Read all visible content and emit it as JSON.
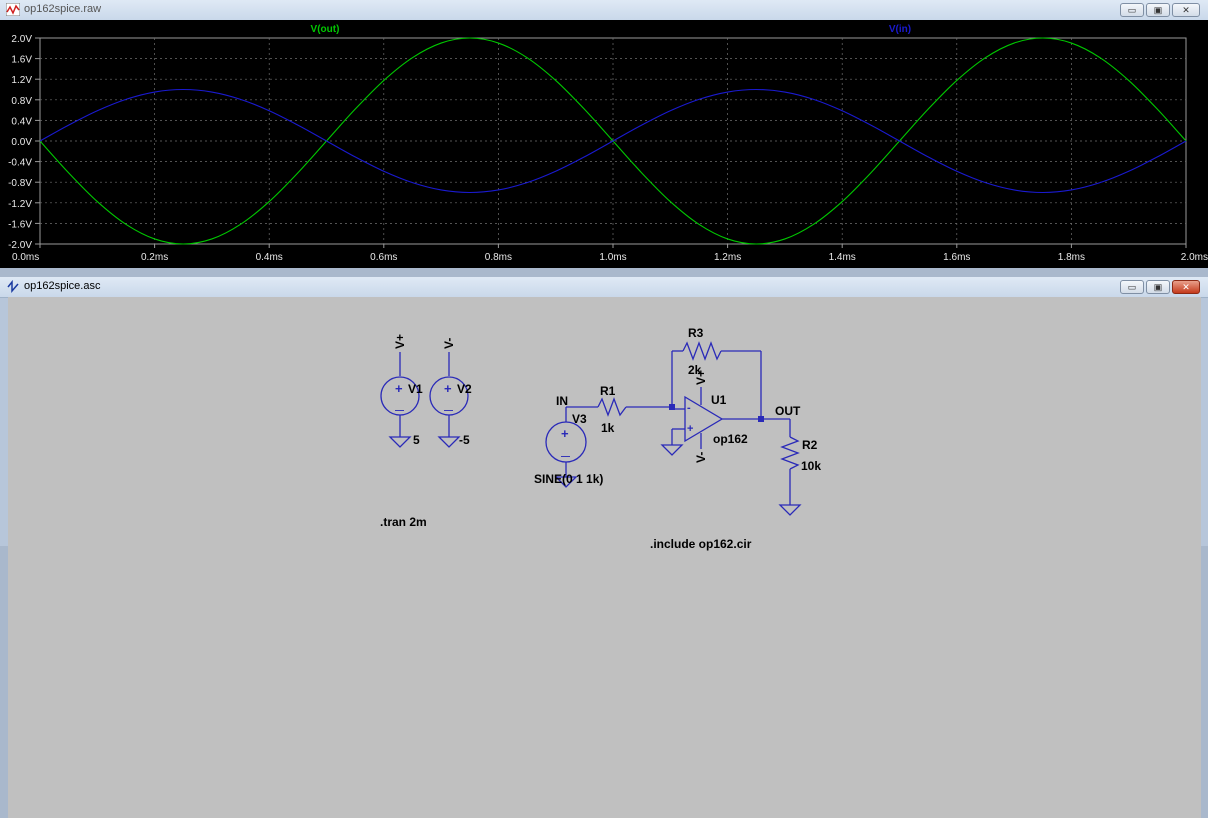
{
  "waveform_window": {
    "title": "op162spice.raw",
    "controls": [
      "minimize",
      "maximize",
      "close"
    ]
  },
  "chart_data": {
    "type": "line",
    "title": "",
    "xlabel": "",
    "ylabel": "",
    "xlim": [
      0,
      2.0
    ],
    "ylim": [
      -2.0,
      2.0
    ],
    "grid": true,
    "x_unit": "ms",
    "y_unit": "V",
    "x_ticks": [
      "0.0ms",
      "0.2ms",
      "0.4ms",
      "0.6ms",
      "0.8ms",
      "1.0ms",
      "1.2ms",
      "1.4ms",
      "1.6ms",
      "1.8ms",
      "2.0ms"
    ],
    "y_ticks": [
      "2.0V",
      "1.6V",
      "1.2V",
      "0.8V",
      "0.4V",
      "0.0V",
      "-0.4V",
      "-0.8V",
      "-1.2V",
      "-1.6V",
      "-2.0V"
    ],
    "series": [
      {
        "name": "V(out)",
        "color": "#00c800",
        "x": [
          0,
          0.05,
          0.1,
          0.15,
          0.2,
          0.25,
          0.3,
          0.35,
          0.4,
          0.45,
          0.5,
          0.55,
          0.6,
          0.65,
          0.7,
          0.75,
          0.8,
          0.85,
          0.9,
          0.95,
          1.0,
          1.05,
          1.1,
          1.15,
          1.2,
          1.25,
          1.3,
          1.35,
          1.4,
          1.45,
          1.5,
          1.55,
          1.6,
          1.65,
          1.7,
          1.75,
          1.8,
          1.85,
          1.9,
          1.95,
          2.0
        ],
        "y": [
          0,
          -0.618,
          -1.176,
          -1.618,
          -1.902,
          -2.0,
          -1.902,
          -1.618,
          -1.176,
          -0.618,
          0,
          0.618,
          1.176,
          1.618,
          1.902,
          2.0,
          1.902,
          1.618,
          1.176,
          0.618,
          0,
          -0.618,
          -1.176,
          -1.618,
          -1.902,
          -2.0,
          -1.902,
          -1.618,
          -1.176,
          -0.618,
          0,
          0.618,
          1.176,
          1.618,
          1.902,
          2.0,
          1.902,
          1.618,
          1.176,
          0.618,
          0
        ]
      },
      {
        "name": "V(in)",
        "color": "#1a1ad0",
        "x": [
          0,
          0.05,
          0.1,
          0.15,
          0.2,
          0.25,
          0.3,
          0.35,
          0.4,
          0.45,
          0.5,
          0.55,
          0.6,
          0.65,
          0.7,
          0.75,
          0.8,
          0.85,
          0.9,
          0.95,
          1.0,
          1.05,
          1.1,
          1.15,
          1.2,
          1.25,
          1.3,
          1.35,
          1.4,
          1.45,
          1.5,
          1.55,
          1.6,
          1.65,
          1.7,
          1.75,
          1.8,
          1.85,
          1.9,
          1.95,
          2.0
        ],
        "y": [
          0,
          0.309,
          0.588,
          0.809,
          0.951,
          1.0,
          0.951,
          0.809,
          0.588,
          0.309,
          0,
          -0.309,
          -0.588,
          -0.809,
          -0.951,
          -1.0,
          -0.951,
          -0.809,
          -0.588,
          -0.309,
          0,
          0.309,
          0.588,
          0.809,
          0.951,
          1.0,
          0.951,
          0.809,
          0.588,
          0.309,
          0,
          -0.309,
          -0.588,
          -0.809,
          -0.951,
          -1.0,
          -0.951,
          -0.809,
          -0.588,
          -0.309,
          0
        ]
      }
    ]
  },
  "schematic_window": {
    "title": "op162spice.asc",
    "controls": [
      "minimize",
      "maximize",
      "close"
    ],
    "labels": {
      "vplus": "V+",
      "vminus": "V-",
      "v1": "V1",
      "v2": "V2",
      "v1_value": "5",
      "v2_value": "-5",
      "in_net": "IN",
      "v3": "V3",
      "v3_value": "SINE(0 1 1k)",
      "r1": "R1",
      "r1_value": "1k",
      "r3": "R3",
      "r3_value": "2k",
      "u1": "U1",
      "u1_value": "op162",
      "out_net": "OUT",
      "r2": "R2",
      "r2_value": "10k",
      "tran": ".tran 2m",
      "include": ".include op162.cir",
      "opamp_plus": "+",
      "opamp_minus": "-",
      "source_plus": "+",
      "source_minus": "—"
    }
  }
}
